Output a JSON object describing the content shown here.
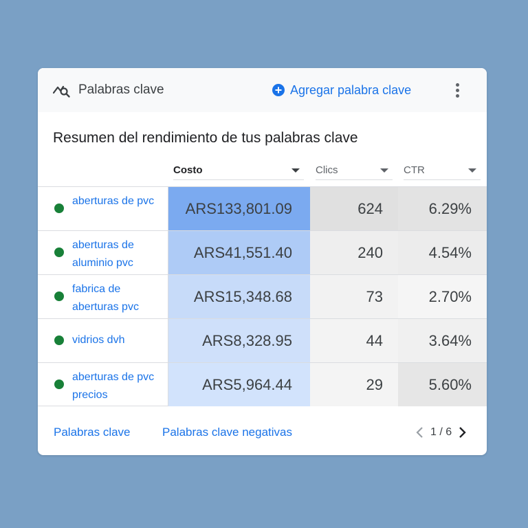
{
  "header": {
    "title": "Palabras clave",
    "title_icon": "keyword-search-icon",
    "add_label": "Agregar palabra clave",
    "add_icon": "add-circle-icon",
    "menu_icon": "more-vert-icon"
  },
  "summary": {
    "title": "Resumen del rendimiento de tus palabras clave"
  },
  "columns": {
    "cost": "Costo",
    "clicks": "Clics",
    "ctr": "CTR"
  },
  "rows": [
    {
      "keyword": "aberturas de pvc",
      "cost": "ARS133,801.09",
      "clicks": "624",
      "ctr": "6.29%",
      "cost_shade": 1.0,
      "ctr_shade": 0.55
    },
    {
      "keyword": "aberturas de aluminio pvc",
      "cost": "ARS41,551.40",
      "clicks": "240",
      "ctr": "4.54%",
      "cost_shade": 0.45,
      "ctr_shade": 0.25
    },
    {
      "keyword": "fabrica de aberturas pvc",
      "cost": "ARS15,348.68",
      "clicks": "73",
      "ctr": "2.70%",
      "cost_shade": 0.3,
      "ctr_shade": 0.05
    },
    {
      "keyword": "vidrios dvh",
      "cost": "ARS8,328.95",
      "clicks": "44",
      "ctr": "3.64%",
      "cost_shade": 0.25,
      "ctr_shade": 0.15
    },
    {
      "keyword": "aberturas de pvc precios",
      "cost": "ARS5,964.44",
      "clicks": "29",
      "ctr": "5.60%",
      "cost_shade": 0.25,
      "ctr_shade": 0.45
    }
  ],
  "footer": {
    "keywords_link": "Palabras clave",
    "negative_link": "Palabras clave negativas",
    "page_indicator": "1 / 6"
  },
  "colors": {
    "accent": "#1a73e8",
    "status_green": "#188038",
    "cost_heat_max": "#7baaf0",
    "cost_heat_min": "#d2e3fc",
    "clicks_heat_max": "#e0e0e0",
    "clicks_heat_min": "#f1f3f4"
  }
}
